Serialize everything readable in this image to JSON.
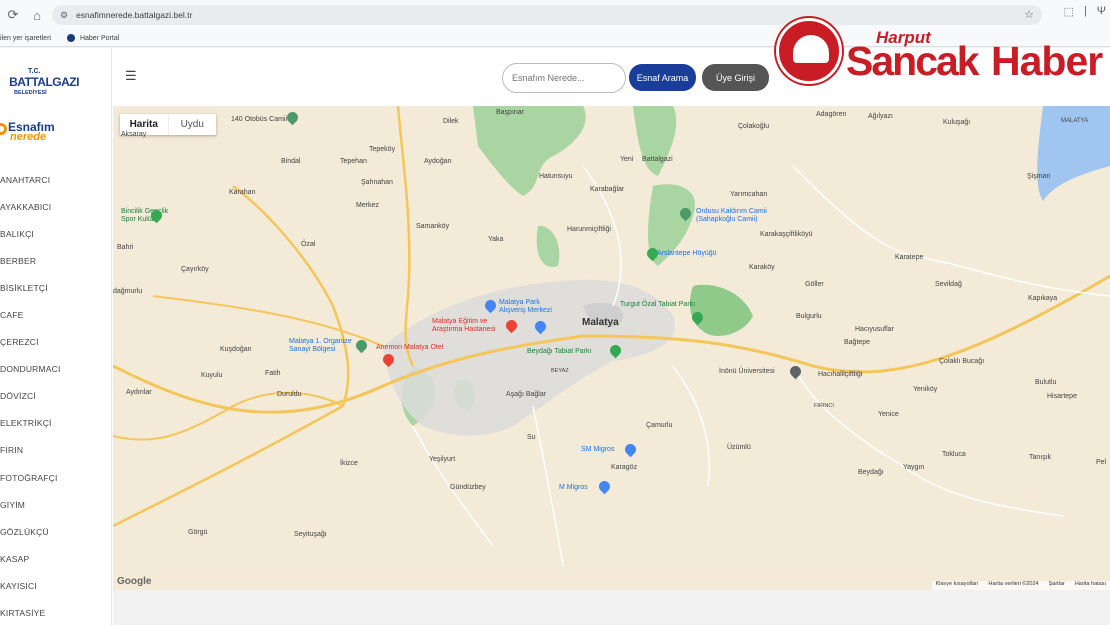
{
  "browser": {
    "url": "esnafimnerede.battalgazi.bel.tr",
    "bookmarks": [
      "ilen yer işaretleri",
      "Haber Portal"
    ]
  },
  "brand": {
    "tc": "T.C.",
    "municipality": "BATTALGAZI",
    "municipality_sub": "BELEDİYESİ",
    "app_top": "Esnafım",
    "app_bottom": "nerede",
    "accent_blue": "#1b3d8f",
    "accent_orange": "#f29400"
  },
  "sidebar": {
    "categories": [
      "ANAHTARCI",
      "AYAKKABICI",
      "BALIKÇI",
      "BERBER",
      "BİSİKLETÇİ",
      "CAFE",
      "ÇEREZCİ",
      "DONDURMACI",
      "DÖVİZCİ",
      "ELEKTRİKÇİ",
      "FIRIN",
      "FOTOĞRAFÇI",
      "GİYİM",
      "GÖZLÜKÇÜ",
      "KASAP",
      "KAYISICI",
      "KIRTASİYE"
    ]
  },
  "header": {
    "search_placeholder": "Esnafım Nerede...",
    "search_button": "Esnaf Arama",
    "login_button": "Üye Girişi"
  },
  "watermark": {
    "line1": "Harput",
    "line2": "Sancak",
    "line3": "Haber",
    "color": "#c81d25"
  },
  "map": {
    "toggle": [
      "Harita",
      "Uydu"
    ],
    "city": "Malatya",
    "places": {
      "aksaray": "Aksaray",
      "otobus": "140 Otobüs Camii",
      "dilek": "Dilek",
      "baspinar": "Başpınar",
      "adagoren": "Adagören",
      "agilyazi": "Ağılyazı",
      "kulusagi": "Kuluşağı",
      "colakoglu": "Çolakoğlu",
      "malatya_top": "MALATYA",
      "bindal": "Bindal",
      "tepehan": "Tepehan",
      "tepekoy": "Tepeköy",
      "aydogan": "Aydoğan",
      "yeni": "Yeni",
      "battalgazi": "Battalgazi",
      "karahan": "Karahan",
      "sahnahan": "Şahnahan",
      "hatunsuyu": "Hatunsuyu",
      "karabaglar": "Karabağlar",
      "yarimcahan": "Yarımcahan",
      "sisman": "Şişman",
      "bincilik": "Bincilik Gençlik",
      "bincilik2": "Spor Kulübü",
      "merkez": "Merkez",
      "samankoy": "Samanköy",
      "harunmiceftligi": "Harunmiçiftliği",
      "kaldirim": "Ordusu Kaldırım Camii",
      "kaldirim2": "(Sahapkoğlu Camii)",
      "karakasciftlik": "Karakaşçiftliköyü",
      "bahri": "Bahri",
      "ozal": "Özal",
      "yaka": "Yaka",
      "arslantepe": "Arslantepe Höyüğü",
      "karatepe": "Karatepe",
      "cayirkoy": "Çayırköy",
      "karakoy": "Karaköy",
      "goller": "Göller",
      "sevildag": "Sevildağ",
      "kapikaya": "Kapıkaya",
      "dagmurlu": "dağmurlu",
      "mpark": "Malatya Park",
      "mpark2": "Alışveriş Merkezi",
      "turgut": "Turgut Özal Tabiat Parkı",
      "bulgurlu": "Bulgurlu",
      "egitim": "Malatya Eğitim ve",
      "egitim2": "Araştırma Hastanesi",
      "hacisuflar": "Hacıyusuflar",
      "bagtepe": "Bağtepe",
      "osb": "Malatya 1. Organize",
      "osb2": "Sanayi Bölgesi",
      "anemon": "Anemon Malatya Otel",
      "beydagi_park": "Beydağı Tabiat Parkı",
      "kusdogan": "Kuşdoğan",
      "colakli": "Çolaklı Bucağı",
      "yenikoy": "Yeniköy",
      "beyaz": "BEYAZ",
      "inonu": "İnönü Üniversitesi",
      "hacihalil": "Hacıhalilçiftliği",
      "kuyulu": "Kuyulu",
      "fatih": "Fatih",
      "bulutlu": "Bulutlu",
      "hisartepe": "Hisartepe",
      "aydinlar": "Aydınlar",
      "duruldu": "Duruldu",
      "asagi": "Aşağı Bağlar",
      "firinci": "FIRINCI",
      "yenice": "Yenice",
      "su": "Su",
      "camurlu": "Çamurlu",
      "uzumlu": "Üzümlü",
      "tokluca": "Tokluca",
      "sm": "SM Migros",
      "ikizce": "İkizce",
      "yesilyurt": "Yeşilyurt",
      "karagoz": "Karagöz",
      "beydagi": "Beydağı",
      "yaygin": "Yaygın",
      "tanisik": "Tanışık",
      "pel": "Pel",
      "mmigros": "M Migros",
      "gundüzbey": "Gündüzbey",
      "gorgu": "Görgü",
      "seyituşagi": "Seyituşağı"
    },
    "google": "Google",
    "footer": [
      "Klavye kısayolları",
      "Harita verileri ©2024",
      "Şartlar",
      "Harita hatası"
    ]
  }
}
